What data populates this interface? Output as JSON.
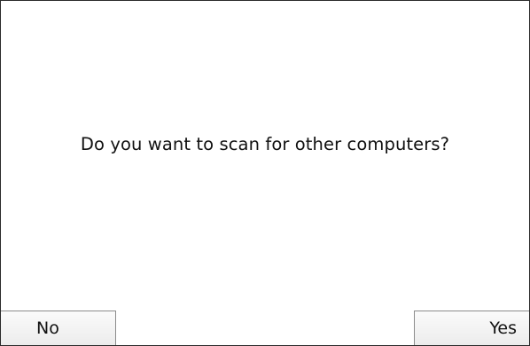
{
  "dialog": {
    "message": "Do you want to scan for other computers?",
    "no_label": "No",
    "yes_label": "Yes"
  }
}
